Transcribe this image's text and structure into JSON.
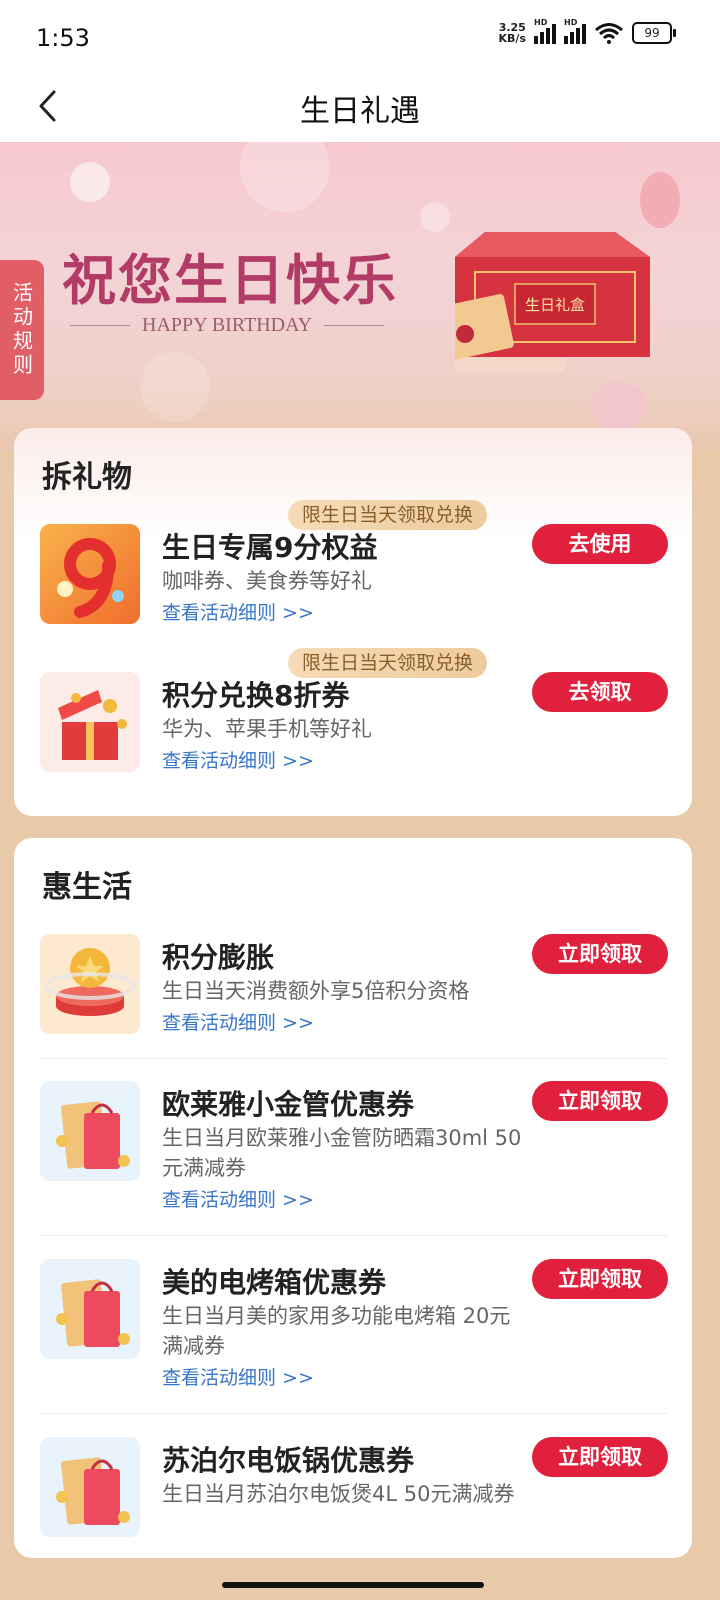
{
  "status_bar": {
    "time": "1:53",
    "net_speed_value": "3.25",
    "net_speed_unit": "KB/s",
    "hd1": "HD",
    "hd2": "HD",
    "battery": "99"
  },
  "nav": {
    "title": "生日礼遇"
  },
  "banner": {
    "title": "祝您生日快乐",
    "subtitle": "HAPPY BIRTHDAY",
    "gift_box_label": "生日礼盒",
    "rules_tab": "活动规则"
  },
  "gift_section": {
    "title": "拆礼物",
    "items": [
      {
        "tag": "限生日当天领取兑换",
        "title": "生日专属9分权益",
        "desc": "咖啡券、美食券等好礼",
        "link": "查看活动细则 >>",
        "button": "去使用"
      },
      {
        "tag": "限生日当天领取兑换",
        "title": "积分兑换8折券",
        "desc": "华为、苹果手机等好礼",
        "link": "查看活动细则 >>",
        "button": "去领取"
      }
    ]
  },
  "life_section": {
    "title": "惠生活",
    "items": [
      {
        "title": "积分膨胀",
        "desc": "生日当天消费额外享5倍积分资格",
        "link": "查看活动细则 >>",
        "button": "立即领取"
      },
      {
        "title": "欧莱雅小金管优惠券",
        "desc": "生日当月欧莱雅小金管防晒霜30ml 50元满减券",
        "link": "查看活动细则 >>",
        "button": "立即领取"
      },
      {
        "title": "美的电烤箱优惠券",
        "desc": "生日当月美的家用多功能电烤箱 20元满减券",
        "link": "查看活动细则 >>",
        "button": "立即领取"
      },
      {
        "title": "苏泊尔电饭锅优惠券",
        "desc": "生日当月苏泊尔电饭煲4L 50元满减券",
        "button": "立即领取"
      }
    ]
  },
  "icons": {
    "back": "chevron-left-icon",
    "signal": "signal-icon",
    "wifi": "wifi-icon",
    "battery": "battery-icon"
  },
  "colors": {
    "accent_red": "#e0203c",
    "link_blue": "#3875c7",
    "tag_gold": "#eecb9c",
    "page_bg": "#e8c9a8"
  }
}
